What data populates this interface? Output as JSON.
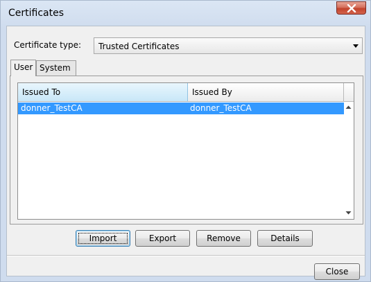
{
  "window": {
    "title": "Certificates"
  },
  "certificate_type": {
    "label": "Certificate type:",
    "selected": "Trusted Certificates"
  },
  "tabs": [
    {
      "label": "User",
      "active": true
    },
    {
      "label": "System",
      "active": false
    }
  ],
  "table": {
    "columns": [
      "Issued To",
      "Issued By"
    ],
    "sorted_column": "Issued To",
    "rows": [
      {
        "issued_to": "donner_TestCA",
        "issued_by": "donner_TestCA",
        "selected": true
      }
    ]
  },
  "buttons": {
    "import": "Import",
    "export": "Export",
    "remove": "Remove",
    "details": "Details",
    "close": "Close"
  },
  "colors": {
    "selection": "#3399ff",
    "sorted_header": "#c8e7f8",
    "close_button": "#c2432c"
  },
  "icons": {
    "close": "close-x-icon",
    "dropdown": "chevron-down-icon",
    "scroll_up": "scroll-up-arrow-icon",
    "scroll_down": "scroll-down-arrow-icon"
  }
}
